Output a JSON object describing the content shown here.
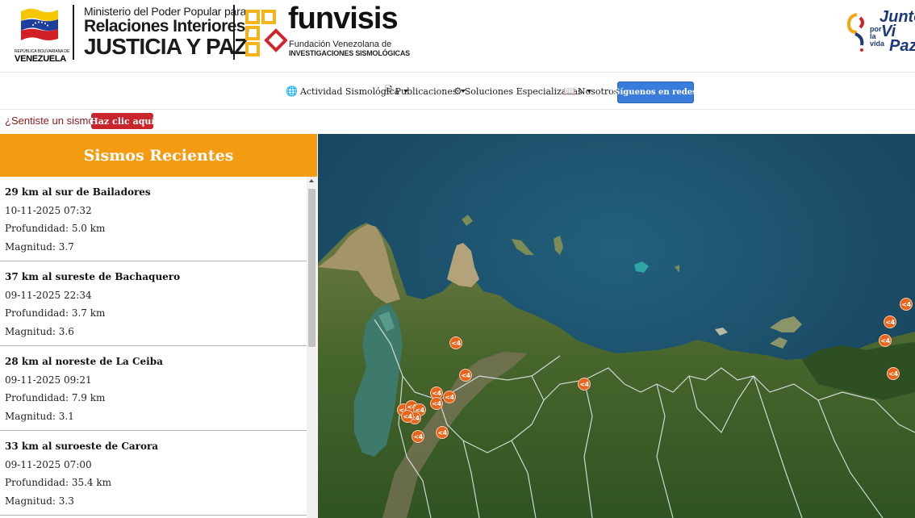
{
  "header": {
    "flag_caption": "REPÚBLICA BOLIVARIANA DE",
    "flag_country": "VENEZUELA",
    "ministry_line1": "Ministerio del Poder Popular para",
    "ministry_line2": "Relaciones Interiores,",
    "ministry_line3": "JUSTICIA Y PAZ",
    "funvisis_name": "funvisis",
    "funvisis_sub1": "Fundación Venezolana de",
    "funvisis_sub2": "INVESTIGACIONES SISMOLÓGICAS",
    "juntos_1": "Junto",
    "juntos_2": "por la vida",
    "juntos_3": "Vi",
    "juntos_4": "Paz"
  },
  "nav": {
    "items": [
      {
        "icon": "globe-icon",
        "label": "Actividad Sismológica"
      },
      {
        "icon": "document-icon",
        "label": "Publicaciones"
      },
      {
        "icon": "gear-icon",
        "label": "Soluciones Especializadas"
      },
      {
        "icon": "book-icon",
        "label": "Nosotros"
      }
    ],
    "social_button": "\"Síguenos en redes\""
  },
  "felt": {
    "question": "¿Sentiste un sismo?",
    "button": "Haz clic aquí"
  },
  "sidebar": {
    "title": "Sismos Recientes",
    "quakes": [
      {
        "title": "29 km al sur de Bailadores",
        "datetime": "10-11-2025 07:32",
        "depth": "Profundidad: 5.0 km",
        "magnitude": "Magnitud: 3.7"
      },
      {
        "title": "37 km al sureste de Bachaquero",
        "datetime": "09-11-2025 22:34",
        "depth": "Profundidad: 3.7 km",
        "magnitude": "Magnitud: 3.6"
      },
      {
        "title": "28 km al noreste de La Ceiba",
        "datetime": "09-11-2025 09:21",
        "depth": "Profundidad: 7.9 km",
        "magnitude": "Magnitud: 3.1"
      },
      {
        "title": "33 km al suroeste de Carora",
        "datetime": "09-11-2025 07:00",
        "depth": "Profundidad: 35.4 km",
        "magnitude": "Magnitud: 3.3"
      }
    ]
  },
  "map": {
    "marker_label": "<4",
    "marker_color": "#e8651b",
    "sea_color": "#1c4e68",
    "land_color": "#4a6b2e"
  },
  "colors": {
    "sidebar_header": "#f39c12",
    "felt_button": "#c8252c",
    "social_button": "#3a7cdc"
  }
}
